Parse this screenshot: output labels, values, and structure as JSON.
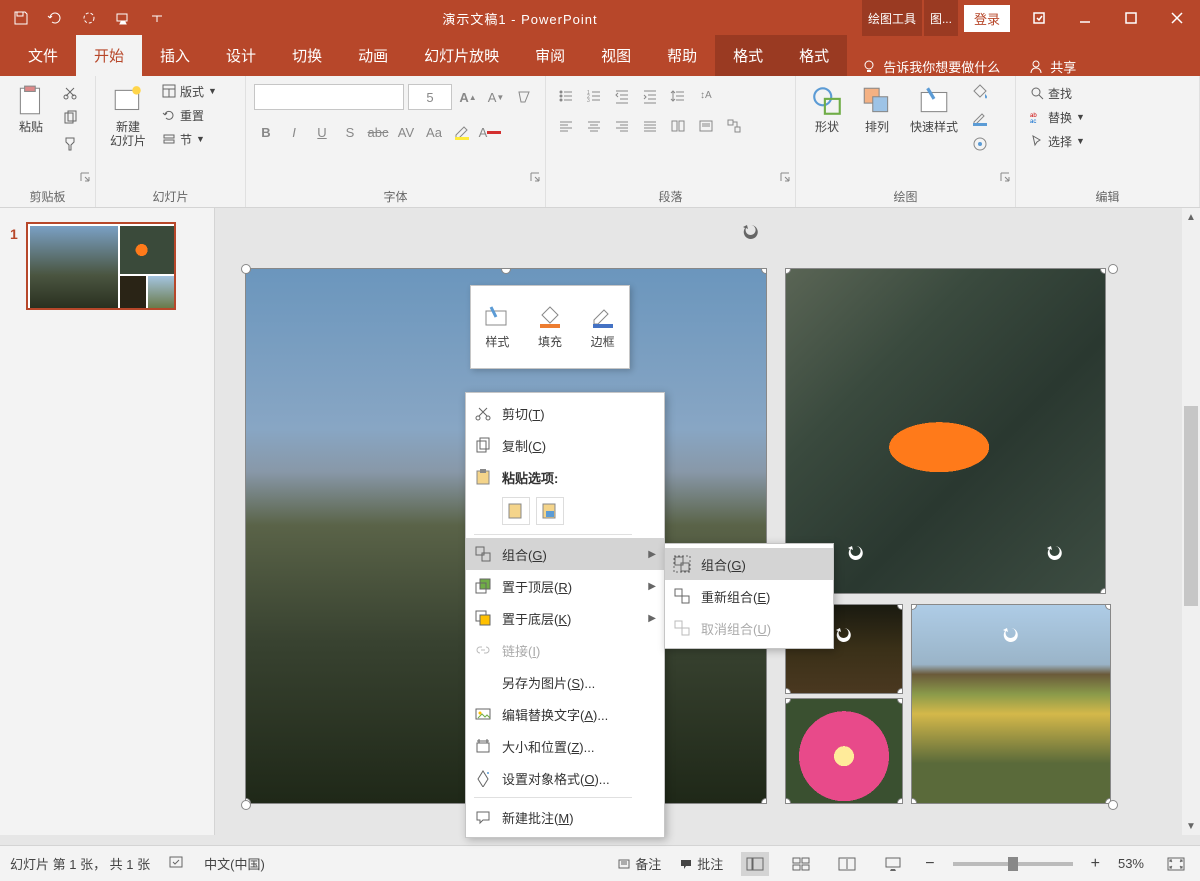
{
  "titlebar": {
    "title": "演示文稿1 - PowerPoint",
    "context_tab1": "绘图工具",
    "context_tab2": "图...",
    "login": "登录"
  },
  "tabs": {
    "file": "文件",
    "home": "开始",
    "insert": "插入",
    "design": "设计",
    "transition": "切换",
    "animation": "动画",
    "slideshow": "幻灯片放映",
    "review": "审阅",
    "view": "视图",
    "help": "帮助",
    "format1": "格式",
    "format2": "格式",
    "tellme": "告诉我你想要做什么",
    "share": "共享"
  },
  "ribbon": {
    "clipboard": {
      "label": "剪贴板",
      "paste": "粘贴"
    },
    "slides": {
      "label": "幻灯片",
      "new": "新建\n幻灯片",
      "layout": "版式",
      "reset": "重置",
      "section": "节"
    },
    "font": {
      "label": "字体",
      "size": "5"
    },
    "paragraph": {
      "label": "段落"
    },
    "drawing": {
      "label": "绘图",
      "shapes": "形状",
      "arrange": "排列",
      "quick": "快速样式"
    },
    "editing": {
      "label": "编辑",
      "find": "查找",
      "replace": "替换",
      "select": "选择"
    }
  },
  "thumbnail": {
    "num": "1"
  },
  "mini": {
    "style": "样式",
    "fill": "填充",
    "border": "边框"
  },
  "context": {
    "cut": "剪切(T)",
    "copy": "复制(C)",
    "paste_header": "粘贴选项:",
    "group": "组合(G)",
    "bring_front": "置于顶层(R)",
    "send_back": "置于底层(K)",
    "link": "链接(I)",
    "save_pic": "另存为图片(S)...",
    "alt_text": "编辑替换文字(A)...",
    "size_pos": "大小和位置(Z)...",
    "format_obj": "设置对象格式(O)...",
    "new_comment": "新建批注(M)"
  },
  "submenu": {
    "group": "组合(G)",
    "regroup": "重新组合(E)",
    "ungroup": "取消组合(U)"
  },
  "status": {
    "slide_info": "幻灯片 第 1 张， 共 1 张",
    "lang": "中文(中国)",
    "notes": "备注",
    "comments": "批注",
    "zoom": "53%"
  }
}
